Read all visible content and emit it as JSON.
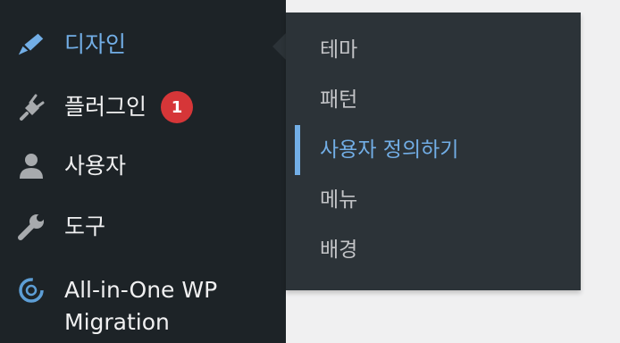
{
  "sidebar": {
    "items": [
      {
        "label": "디자인",
        "icon": "paintbrush-icon",
        "active": true
      },
      {
        "label": "플러그인",
        "icon": "plugin-icon",
        "badge": "1"
      },
      {
        "label": "사용자",
        "icon": "user-icon"
      },
      {
        "label": "도구",
        "icon": "wrench-icon"
      },
      {
        "label_line1": "All-in-One WP",
        "label_line2": "Migration",
        "icon": "migration-icon"
      }
    ]
  },
  "submenu": {
    "items": [
      {
        "label": "테마"
      },
      {
        "label": "패턴"
      },
      {
        "label": "사용자 정의하기",
        "current": true
      },
      {
        "label": "메뉴"
      },
      {
        "label": "배경"
      }
    ]
  },
  "colors": {
    "sidebar_bg": "#1d2327",
    "submenu_bg": "#2c3338",
    "accent": "#72aee6",
    "badge": "#d63638",
    "page_bg": "#f0f0f1"
  }
}
